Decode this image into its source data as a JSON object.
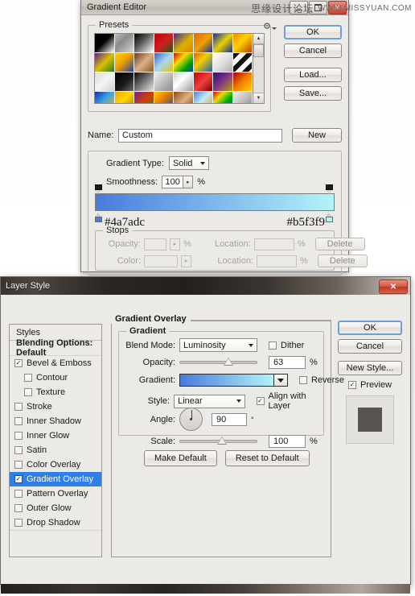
{
  "watermark": {
    "cn": "思缘设计论坛",
    "url": "WWW.MISSYUAN.COM"
  },
  "gradient_editor": {
    "title": "Gradient Editor",
    "window_buttons": {
      "minimize": "minimize-icon",
      "maximize": "maximize-icon",
      "close": "✕"
    },
    "presets": {
      "legend": "Presets",
      "gear_icon": "gear-icon",
      "swatches": [
        "linear-gradient(135deg,#000 0%,#000 45%,#fff 100%)",
        "linear-gradient(135deg,#bdbdbd 0%,#8a8a8a 40%,#d8d8d8 100%)",
        "linear-gradient(135deg,#000 0%,#555 40%,#fff 100%)",
        "linear-gradient(135deg,#c00000 0%,#d02020 50%,#1a5a1a 100%)",
        "linear-gradient(135deg,#4b2a8a 0%,#d8b400 55%,#e08000 100%)",
        "linear-gradient(135deg,#e06a00 0%,#f0a000 50%,#1030a0 100%)",
        "linear-gradient(135deg,#1030a0 0%,#e8d000 50%,#1030a0 100%)",
        "linear-gradient(135deg,#f09000 0%,#ffd000 45%,#c04000 100%)",
        "linear-gradient(135deg,#5a2080 0%,#d8c000 50%,#2a7a2a 100%)",
        "linear-gradient(135deg,#ffd400 0%,#f0a000 45%,#2040b0 100%)",
        "linear-gradient(135deg,#6a3a1a 0%,#d8b088 50%,#8a5a2a 100%)",
        "linear-gradient(135deg,#3a6ac0 0%,#a8d8f0 50%,#e8c000 100%)",
        "linear-gradient(135deg,#e00000 0%,#f0e000 35%,#00a000 70%,#0040c0 100%)",
        "linear-gradient(135deg,#e06000 0%,#f0d000 40%,#2060c0 100%)",
        "linear-gradient(135deg,#ffffff 0%,#e0e0e0 50%,#b0b0b0 100%)",
        "repeating-linear-gradient(135deg,#111 0 6px,#fff 6px 12px)",
        "linear-gradient(135deg,#dcdcdc 0%,#f4f4f4 50%,#cfcfcf 100%)",
        "linear-gradient(135deg,#000 0%,#1a1a1a 55%,#6a6a6a 100%)",
        "linear-gradient(135deg,#0a0a0a 0%,#777 50%,#e8e8e8 100%)",
        "linear-gradient(135deg,#efefef 0%,#bdbdbd 50%,#8a8a8a 100%)",
        "linear-gradient(135deg,#d0d0d0 0%,#fff 40%,#9a9a9a 100%)",
        "linear-gradient(135deg,#c00000 0%,#f04040 50%,#7a0000 100%)",
        "linear-gradient(135deg,#2a1060 0%,#7a3090 45%,#c0a000 100%)",
        "linear-gradient(135deg,#b00000 0%,#f08000 50%,#ffd000 100%)",
        "linear-gradient(135deg,#1030b0 0%,#40a0e0 45%,#f0c000 100%)",
        "linear-gradient(135deg,#f0a000 0%,#ffd800 45%,#c06000 100%)",
        "linear-gradient(135deg,#7a2090 0%,#d04000 50%,#2a8a2a 100%)",
        "linear-gradient(135deg,#ffd000 0%,#e88000 40%,#1040b0 100%)",
        "linear-gradient(135deg,#8a4a20 0%,#e0b080 50%,#6a3a18 100%)",
        "linear-gradient(135deg,#3a8ad8 0%,#c8e8f8 45%,#d8a000 100%)",
        "linear-gradient(135deg,#e00000 0%,#e8e000 30%,#00b000 60%,#0040c0 100%)",
        "linear-gradient(135deg,#f0f0f0 0%,#c0c0c0 50%,#808080 100%)",
        "repeating-linear-gradient(135deg,#111 0 5px,#f4f4f4 5px 10px)",
        "linear-gradient(135deg,#cfcfcf 0%,#fbfbfb 50%,#a8a8a8 100%)",
        "linear-gradient(135deg,#000 0%,#2a2a2a 50%,#9a9a9a 100%)",
        "linear-gradient(135deg,#1040c0 0%,#4a90e0 50%,#0a2080 100%)",
        "linear-gradient(135deg,#3060d0 0%,#80b8f0 45%,#1a3a90 100%)",
        "linear-gradient(135deg,#6a3a9a 0%,#a87ad0 50%,#3a1a6a 100%)",
        "linear-gradient(135deg,#d8d8d8 0%,#9a9a9a 50%,#6a6a6a 100%)",
        "linear-gradient(135deg,#f0c000 0%,#e07000 50%,#a03000 100%)"
      ],
      "scrollbar": {
        "up": "▲",
        "down": "▼"
      }
    },
    "buttons": {
      "ok": "OK",
      "cancel": "Cancel",
      "load": "Load...",
      "save": "Save..."
    },
    "name": {
      "label": "Name:",
      "value": "Custom",
      "new_button": "New"
    },
    "gradient_type": {
      "label": "Gradient Type:",
      "value": "Solid"
    },
    "smoothness": {
      "label": "Smoothness:",
      "value": "100",
      "unit": "%"
    },
    "ramp": {
      "start_color": "#4a7adc",
      "end_color": "#b5f3f9",
      "start_hex_label": "#4a7adc",
      "end_hex_label": "#b5f3f9"
    },
    "stops": {
      "legend": "Stops",
      "opacity_label": "Opacity:",
      "opacity_value": "",
      "opacity_unit": "%",
      "color_label": "Color:",
      "location_label": "Location:",
      "location_value": "",
      "location_unit": "%",
      "delete_label": "Delete"
    }
  },
  "layer_style": {
    "title": "Layer Style",
    "close": "✕",
    "styles_header": "Styles",
    "items": [
      {
        "label": "Blending Options: Default",
        "checkbox": false,
        "has_checkbox": false,
        "indent": false,
        "selected": false
      },
      {
        "label": "Bevel & Emboss",
        "checkbox": true,
        "has_checkbox": true,
        "indent": false,
        "selected": false
      },
      {
        "label": "Contour",
        "checkbox": false,
        "has_checkbox": true,
        "indent": true,
        "selected": false
      },
      {
        "label": "Texture",
        "checkbox": false,
        "has_checkbox": true,
        "indent": true,
        "selected": false
      },
      {
        "label": "Stroke",
        "checkbox": false,
        "has_checkbox": true,
        "indent": false,
        "selected": false
      },
      {
        "label": "Inner Shadow",
        "checkbox": false,
        "has_checkbox": true,
        "indent": false,
        "selected": false
      },
      {
        "label": "Inner Glow",
        "checkbox": false,
        "has_checkbox": true,
        "indent": false,
        "selected": false
      },
      {
        "label": "Satin",
        "checkbox": false,
        "has_checkbox": true,
        "indent": false,
        "selected": false
      },
      {
        "label": "Color Overlay",
        "checkbox": false,
        "has_checkbox": true,
        "indent": false,
        "selected": false
      },
      {
        "label": "Gradient Overlay",
        "checkbox": true,
        "has_checkbox": true,
        "indent": false,
        "selected": true
      },
      {
        "label": "Pattern Overlay",
        "checkbox": false,
        "has_checkbox": true,
        "indent": false,
        "selected": false
      },
      {
        "label": "Outer Glow",
        "checkbox": false,
        "has_checkbox": true,
        "indent": false,
        "selected": false
      },
      {
        "label": "Drop Shadow",
        "checkbox": false,
        "has_checkbox": true,
        "indent": false,
        "selected": false
      }
    ],
    "panel": {
      "title": "Gradient Overlay",
      "group_legend": "Gradient",
      "blend_mode": {
        "label": "Blend Mode:",
        "value": "Luminosity"
      },
      "dither": {
        "label": "Dither",
        "checked": false
      },
      "opacity": {
        "label": "Opacity:",
        "value": "63",
        "unit": "%",
        "percent": 63
      },
      "gradient": {
        "label": "Gradient:",
        "start": "#4a7adc",
        "end": "#b5f3f9"
      },
      "reverse": {
        "label": "Reverse",
        "checked": false
      },
      "style": {
        "label": "Style:",
        "value": "Linear"
      },
      "align": {
        "label": "Align with Layer",
        "checked": true
      },
      "angle": {
        "label": "Angle:",
        "value": "90",
        "unit": "°"
      },
      "scale": {
        "label": "Scale:",
        "value": "100",
        "unit": "%",
        "percent": 55
      },
      "make_default": "Make Default",
      "reset_default": "Reset to Default"
    },
    "buttons": {
      "ok": "OK",
      "cancel": "Cancel",
      "new_style": "New Style...",
      "preview": "Preview",
      "preview_checked": true
    }
  }
}
